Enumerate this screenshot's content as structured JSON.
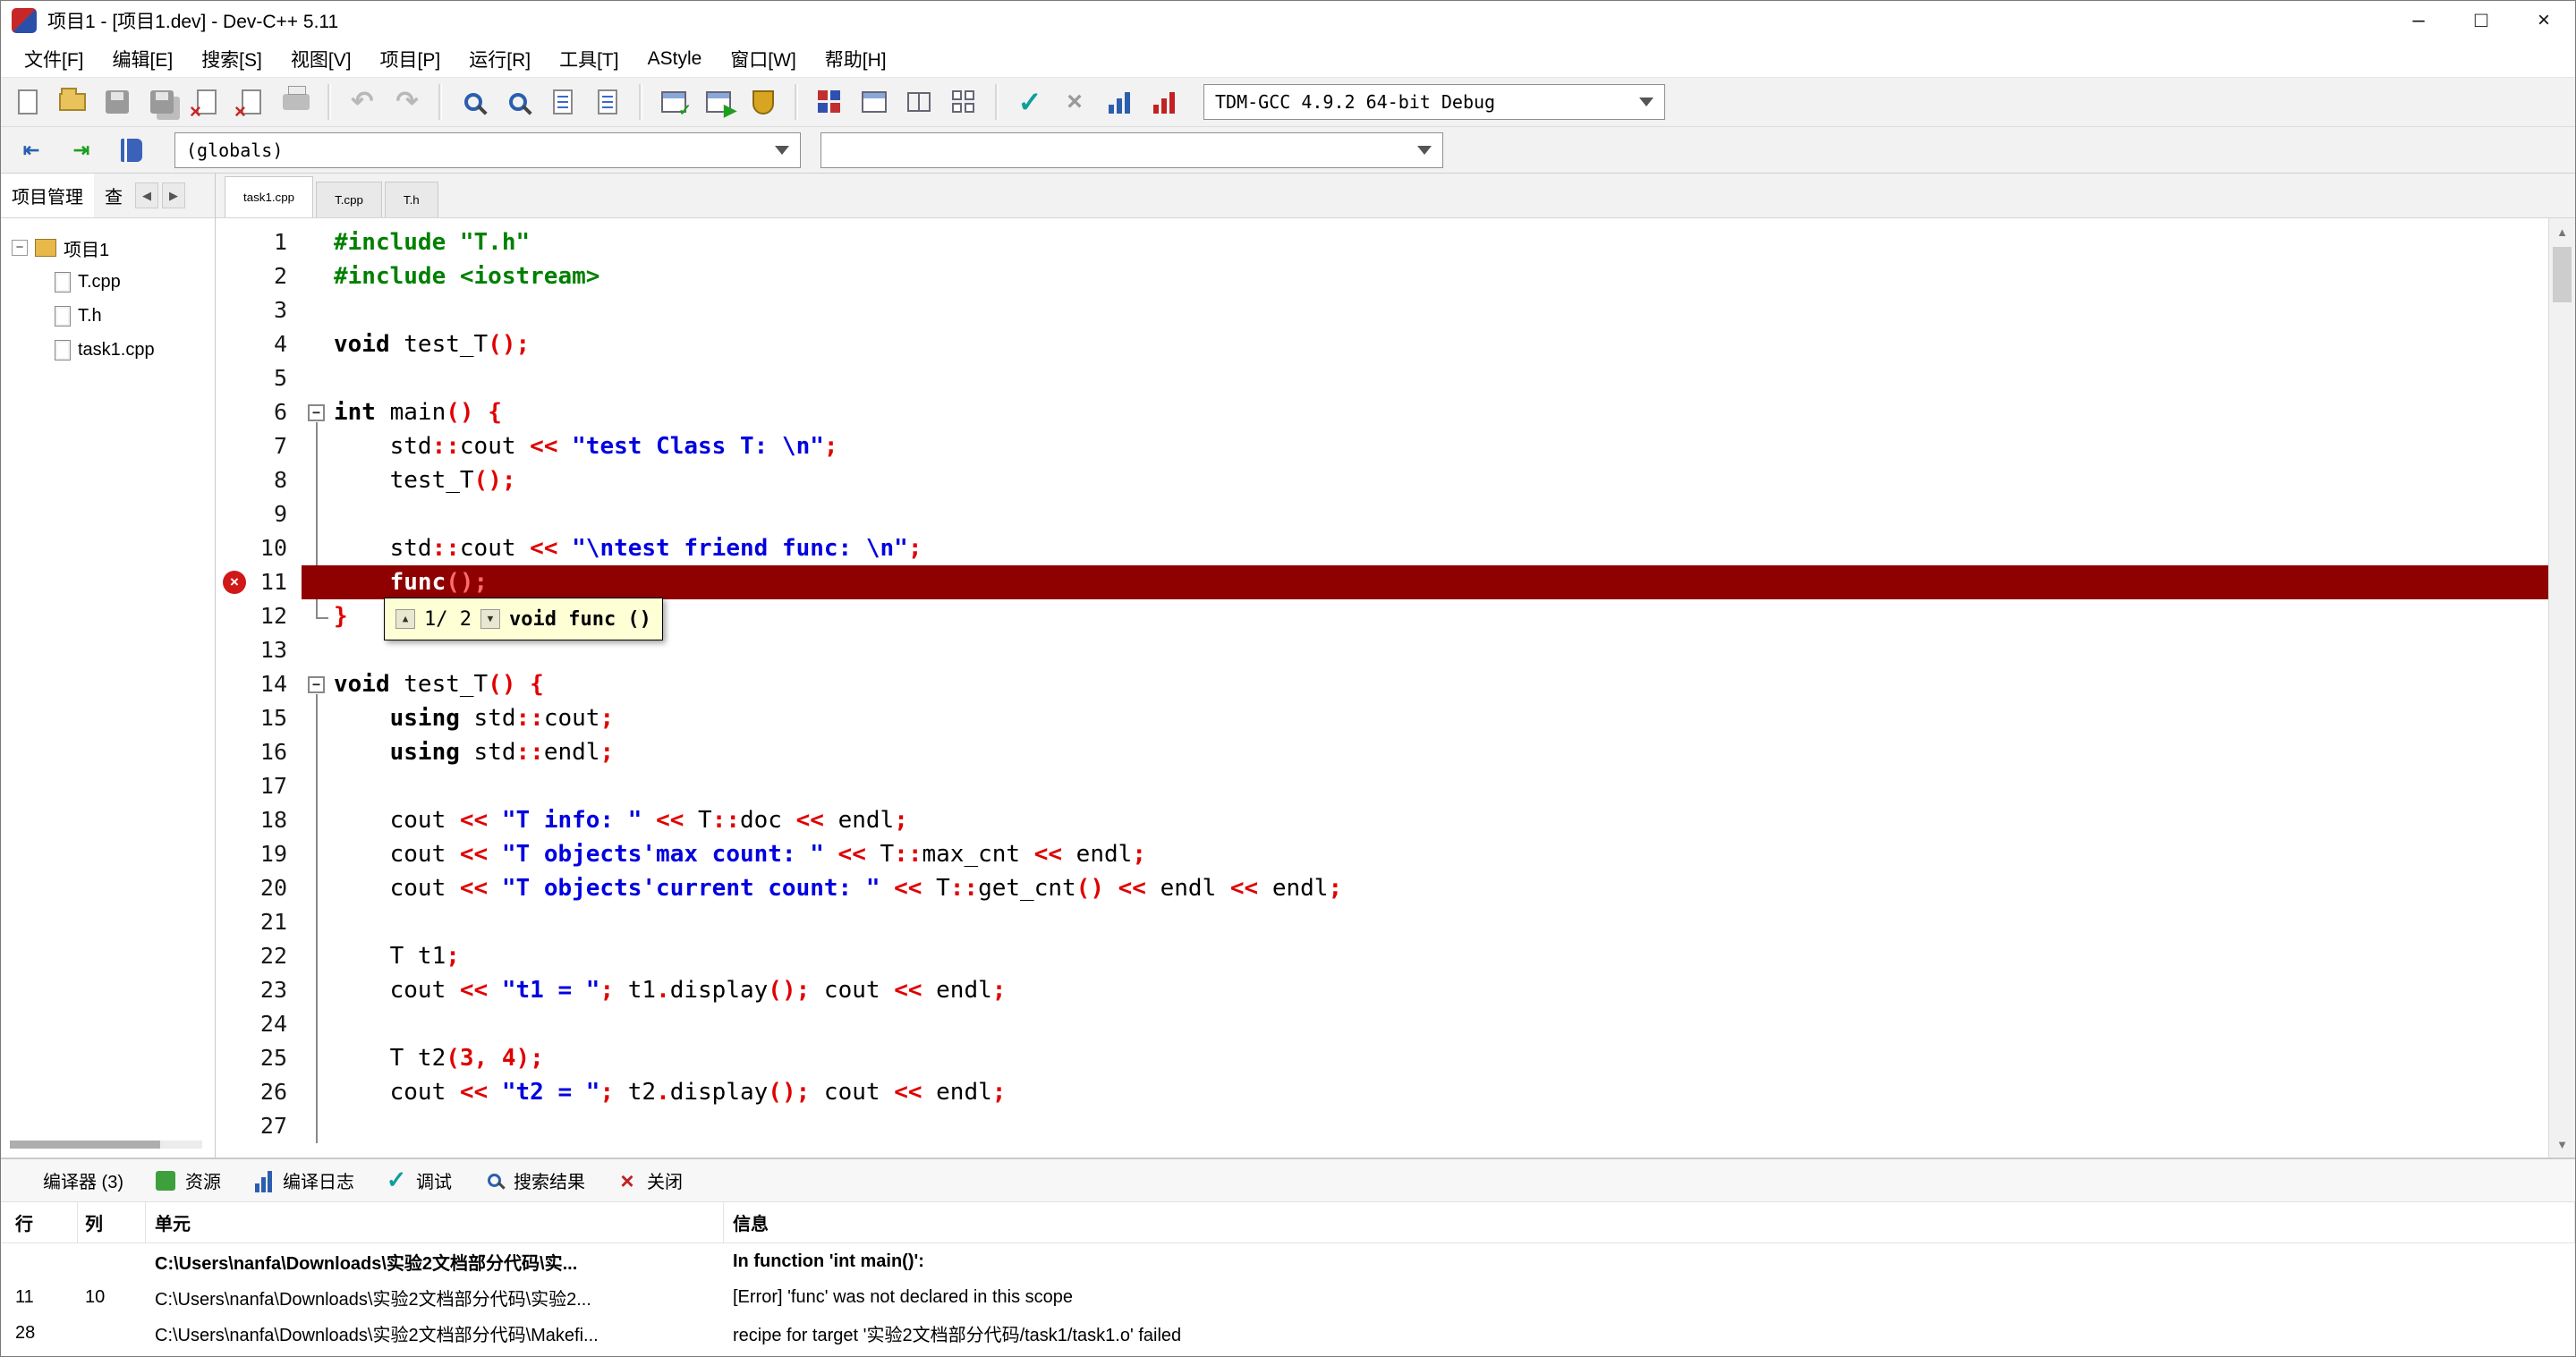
{
  "window": {
    "title": "项目1 - [项目1.dev] - Dev-C++ 5.11"
  },
  "menu": {
    "items": [
      "文件[F]",
      "编辑[E]",
      "搜索[S]",
      "视图[V]",
      "项目[P]",
      "运行[R]",
      "工具[T]",
      "AStyle",
      "窗口[W]",
      "帮助[H]"
    ]
  },
  "toolbar": {
    "compiler": "TDM-GCC 4.9.2 64-bit Debug"
  },
  "nav": {
    "globals": "(globals)",
    "member": ""
  },
  "project": {
    "tabs": [
      "项目管理",
      "查"
    ],
    "root": "项目1",
    "items": [
      "T.cpp",
      "T.h",
      "task1.cpp"
    ]
  },
  "editor": {
    "tabs": [
      "task1.cpp",
      "T.cpp",
      "T.h"
    ],
    "active_tab": "task1.cpp",
    "lines": [
      {
        "n": 1,
        "fold": "",
        "seg": [
          [
            "p",
            "#include \"T.h\""
          ]
        ]
      },
      {
        "n": 2,
        "fold": "",
        "seg": [
          [
            "p",
            "#include <iostream>"
          ]
        ]
      },
      {
        "n": 3,
        "fold": "",
        "seg": []
      },
      {
        "n": 4,
        "fold": "",
        "seg": [
          [
            "k",
            "void"
          ],
          [
            "d",
            " test_T"
          ],
          [
            "y",
            "();"
          ]
        ]
      },
      {
        "n": 5,
        "fold": "",
        "seg": []
      },
      {
        "n": 6,
        "fold": "start",
        "seg": [
          [
            "k",
            "int"
          ],
          [
            "d",
            " main"
          ],
          [
            "y",
            "() {"
          ]
        ]
      },
      {
        "n": 7,
        "fold": "line",
        "seg": [
          [
            "d",
            "    std"
          ],
          [
            "y",
            "::"
          ],
          [
            "d",
            "cout "
          ],
          [
            "y",
            "<<"
          ],
          [
            "d",
            " "
          ],
          [
            "s",
            "\"test Class T: \\n\""
          ],
          [
            "y",
            ";"
          ]
        ]
      },
      {
        "n": 8,
        "fold": "line",
        "seg": [
          [
            "d",
            "    test_T"
          ],
          [
            "y",
            "();"
          ]
        ]
      },
      {
        "n": 9,
        "fold": "line",
        "seg": []
      },
      {
        "n": 10,
        "fold": "line",
        "seg": [
          [
            "d",
            "    std"
          ],
          [
            "y",
            "::"
          ],
          [
            "d",
            "cout "
          ],
          [
            "y",
            "<<"
          ],
          [
            "d",
            " "
          ],
          [
            "s",
            "\"\\ntest friend func: \\n\""
          ],
          [
            "y",
            ";"
          ]
        ]
      },
      {
        "n": 11,
        "fold": "line",
        "hl": true,
        "err": true,
        "seg": [
          [
            "w",
            "    func"
          ],
          [
            "hy",
            "();"
          ]
        ]
      },
      {
        "n": 12,
        "fold": "end",
        "seg": [
          [
            "y",
            "}"
          ]
        ]
      },
      {
        "n": 13,
        "fold": "",
        "seg": []
      },
      {
        "n": 14,
        "fold": "start",
        "seg": [
          [
            "k",
            "void"
          ],
          [
            "d",
            " test_T"
          ],
          [
            "y",
            "() {"
          ]
        ]
      },
      {
        "n": 15,
        "fold": "line",
        "seg": [
          [
            "d",
            "    "
          ],
          [
            "k",
            "using"
          ],
          [
            "d",
            " std"
          ],
          [
            "y",
            "::"
          ],
          [
            "d",
            "cout"
          ],
          [
            "y",
            ";"
          ]
        ]
      },
      {
        "n": 16,
        "fold": "line",
        "seg": [
          [
            "d",
            "    "
          ],
          [
            "k",
            "using"
          ],
          [
            "d",
            " std"
          ],
          [
            "y",
            "::"
          ],
          [
            "d",
            "endl"
          ],
          [
            "y",
            ";"
          ]
        ]
      },
      {
        "n": 17,
        "fold": "line",
        "seg": []
      },
      {
        "n": 18,
        "fold": "line",
        "seg": [
          [
            "d",
            "    cout "
          ],
          [
            "y",
            "<<"
          ],
          [
            "d",
            " "
          ],
          [
            "s",
            "\"T info: \""
          ],
          [
            "d",
            " "
          ],
          [
            "y",
            "<<"
          ],
          [
            "d",
            " T"
          ],
          [
            "y",
            "::"
          ],
          [
            "d",
            "doc "
          ],
          [
            "y",
            "<<"
          ],
          [
            "d",
            " endl"
          ],
          [
            "y",
            ";"
          ]
        ]
      },
      {
        "n": 19,
        "fold": "line",
        "seg": [
          [
            "d",
            "    cout "
          ],
          [
            "y",
            "<<"
          ],
          [
            "d",
            " "
          ],
          [
            "s",
            "\"T objects'max count: \""
          ],
          [
            "d",
            " "
          ],
          [
            "y",
            "<<"
          ],
          [
            "d",
            " T"
          ],
          [
            "y",
            "::"
          ],
          [
            "d",
            "max_cnt "
          ],
          [
            "y",
            "<<"
          ],
          [
            "d",
            " endl"
          ],
          [
            "y",
            ";"
          ]
        ]
      },
      {
        "n": 20,
        "fold": "line",
        "seg": [
          [
            "d",
            "    cout "
          ],
          [
            "y",
            "<<"
          ],
          [
            "d",
            " "
          ],
          [
            "s",
            "\"T objects'current count: \""
          ],
          [
            "d",
            " "
          ],
          [
            "y",
            "<<"
          ],
          [
            "d",
            " T"
          ],
          [
            "y",
            "::"
          ],
          [
            "d",
            "get_cnt"
          ],
          [
            "y",
            "()"
          ],
          [
            "d",
            " "
          ],
          [
            "y",
            "<<"
          ],
          [
            "d",
            " endl "
          ],
          [
            "y",
            "<<"
          ],
          [
            "d",
            " endl"
          ],
          [
            "y",
            ";"
          ]
        ]
      },
      {
        "n": 21,
        "fold": "line",
        "seg": []
      },
      {
        "n": 22,
        "fold": "line",
        "seg": [
          [
            "d",
            "    T t1"
          ],
          [
            "y",
            ";"
          ]
        ]
      },
      {
        "n": 23,
        "fold": "line",
        "seg": [
          [
            "d",
            "    cout "
          ],
          [
            "y",
            "<<"
          ],
          [
            "d",
            " "
          ],
          [
            "s",
            "\"t1 = \""
          ],
          [
            "y",
            ";"
          ],
          [
            "d",
            " t1"
          ],
          [
            "y",
            "."
          ],
          [
            "d",
            "display"
          ],
          [
            "y",
            "();"
          ],
          [
            "d",
            " cout "
          ],
          [
            "y",
            "<<"
          ],
          [
            "d",
            " endl"
          ],
          [
            "y",
            ";"
          ]
        ]
      },
      {
        "n": 24,
        "fold": "line",
        "seg": []
      },
      {
        "n": 25,
        "fold": "line",
        "seg": [
          [
            "d",
            "    T t2"
          ],
          [
            "y",
            "("
          ],
          [
            "n2",
            "3"
          ],
          [
            "y",
            ","
          ],
          [
            "d",
            " "
          ],
          [
            "n2",
            "4"
          ],
          [
            "y",
            ");"
          ]
        ]
      },
      {
        "n": 26,
        "fold": "line",
        "seg": [
          [
            "d",
            "    cout "
          ],
          [
            "y",
            "<<"
          ],
          [
            "d",
            " "
          ],
          [
            "s",
            "\"t2 = \""
          ],
          [
            "y",
            ";"
          ],
          [
            "d",
            " t2"
          ],
          [
            "y",
            "."
          ],
          [
            "d",
            "display"
          ],
          [
            "y",
            "();"
          ],
          [
            "d",
            " cout "
          ],
          [
            "y",
            "<<"
          ],
          [
            "d",
            " endl"
          ],
          [
            "y",
            ";"
          ]
        ]
      },
      {
        "n": 27,
        "fold": "line",
        "seg": []
      }
    ]
  },
  "calltip": {
    "counter": "1/ 2",
    "signature": "void func ()"
  },
  "report": {
    "tabs": [
      "编译器 (3)",
      "资源",
      "编译日志",
      "调试",
      "搜索结果",
      "关闭"
    ],
    "headers": [
      "行",
      "列",
      "单元",
      "信息"
    ],
    "rows": [
      {
        "line": "",
        "col": "",
        "unit": "C:\\Users\\nanfa\\Downloads\\实验2文档部分代码\\实...",
        "msg": "In function 'int main()':"
      },
      {
        "line": "11",
        "col": "10",
        "unit": "C:\\Users\\nanfa\\Downloads\\实验2文档部分代码\\实验2...",
        "msg": "[Error] 'func' was not declared in this scope"
      },
      {
        "line": "28",
        "col": "",
        "unit": "C:\\Users\\nanfa\\Downloads\\实验2文档部分代码\\Makefi...",
        "msg": "recipe for target '实验2文档部分代码/task1/task1.o' failed"
      }
    ]
  },
  "colors": {
    "error_line_bg": "#8f0000",
    "string": "#0000e0",
    "symbol": "#e00000",
    "preprocessor": "#008000",
    "calltip_bg": "#ffffd6"
  }
}
